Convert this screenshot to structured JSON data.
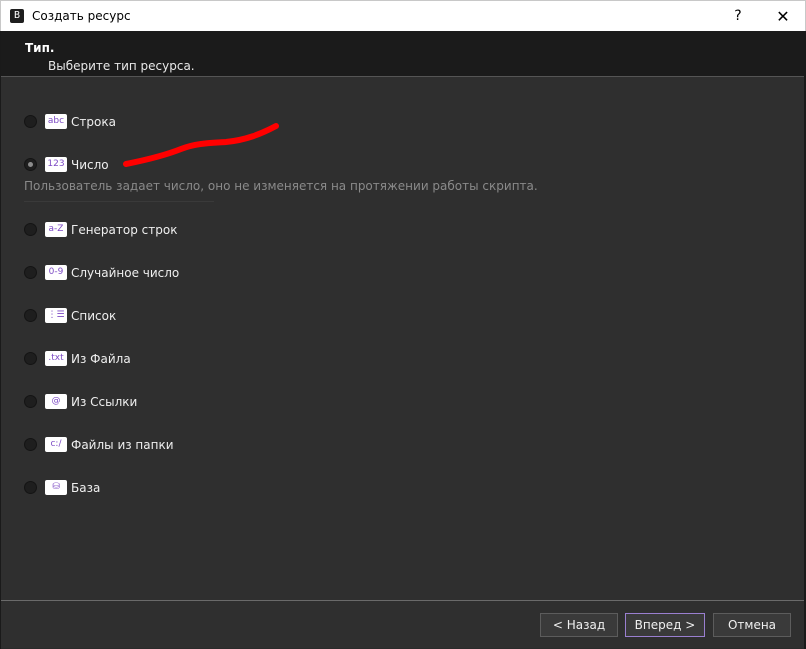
{
  "window": {
    "title": "Создать ресурс",
    "icon_glyph": "B",
    "help_label": "?",
    "close_label": "✕"
  },
  "header": {
    "title": "Тип.",
    "subtitle": "Выберите тип ресурса."
  },
  "options": [
    {
      "badge": "abc",
      "label": "Строка",
      "icon": "text-string-icon",
      "checked": false
    },
    {
      "badge": "123",
      "label": "Число",
      "icon": "number-icon",
      "checked": true
    },
    {
      "badge": "a-Z",
      "label": "Генератор строк",
      "icon": "string-generator-icon",
      "checked": false
    },
    {
      "badge": "0-9",
      "label": "Случайное число",
      "icon": "random-number-icon",
      "checked": false
    },
    {
      "badge": "⋮☰",
      "label": "Список",
      "icon": "list-icon",
      "checked": false
    },
    {
      "badge": ".txt",
      "label": "Из Файла",
      "icon": "file-icon",
      "checked": false
    },
    {
      "badge": "@",
      "label": "Из Ссылки",
      "icon": "link-icon",
      "checked": false
    },
    {
      "badge": "c:/",
      "label": "Файлы из папки",
      "icon": "folder-icon",
      "checked": false
    },
    {
      "badge": "⛁",
      "label": "База",
      "icon": "database-icon",
      "checked": false
    }
  ],
  "description": "Пользователь задает число, оно не изменяется на протяжении работы скрипта.",
  "buttons": {
    "back": "< Назад",
    "next": "Вперед >",
    "cancel": "Отмена"
  },
  "colors": {
    "accent_badge_text": "#7d4bc4",
    "annotation_red": "#ff0000",
    "primary_button_border": "#9a7fd0"
  }
}
